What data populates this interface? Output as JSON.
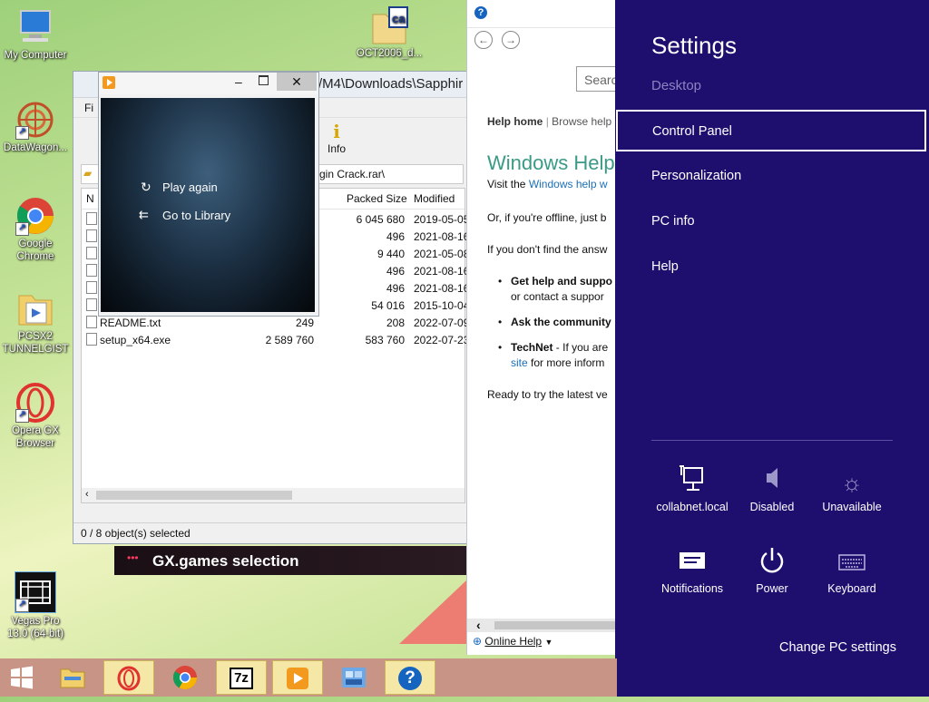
{
  "desktop": {
    "icons": [
      {
        "label": "My Computer",
        "icon": "computer-icon"
      },
      {
        "label": "DataWagon...",
        "icon": "datawagon-icon"
      },
      {
        "label": "Google Chrome",
        "icon": "chrome-icon"
      },
      {
        "label": "PCSX2 TUNNELGIST",
        "icon": "folder-icon"
      },
      {
        "label": "Opera GX Browser",
        "icon": "opera-gx-icon"
      },
      {
        "label": "Vegas Pro 13.0 (64-bit)",
        "icon": "vegas-icon"
      },
      {
        "label": "OCT2006_d...",
        "icon": "file-icon"
      }
    ],
    "gx_banner": "GX.games selection"
  },
  "archive_window": {
    "path": "/M4\\Downloads\\Sapphir",
    "menu_first": "Fi",
    "toolbar_info": "Info",
    "address": "gin Crack.rar\\",
    "columns": {
      "name": "N",
      "size": "",
      "packed": "Packed Size",
      "modified": "Modified"
    },
    "rows": [
      {
        "name": "",
        "size": "",
        "packed": "6 045 680",
        "modified": "2019-05-05"
      },
      {
        "name": "",
        "size": "",
        "packed": "496",
        "modified": "2021-08-16"
      },
      {
        "name": "",
        "size": "",
        "packed": "9 440",
        "modified": "2021-05-08"
      },
      {
        "name": "",
        "size": "",
        "packed": "496",
        "modified": "2021-08-16"
      },
      {
        "name": "",
        "size": "",
        "packed": "496",
        "modified": "2021-08-16"
      },
      {
        "name": "",
        "size": "",
        "packed": "54 016",
        "modified": "2015-10-04"
      },
      {
        "name": "README.txt",
        "size": "249",
        "packed": "208",
        "modified": "2022-07-09"
      },
      {
        "name": "setup_x64.exe",
        "size": "2 589 760",
        "packed": "583 760",
        "modified": "2022-07-23"
      }
    ],
    "status": "0 / 8 object(s) selected"
  },
  "player": {
    "play_again": "Play again",
    "go_to_library": "Go to Library"
  },
  "help": {
    "search_placeholder": "Search",
    "nav_home": "Help home",
    "nav_browse": "Browse help",
    "title": "Windows Help",
    "visit_prefix": "Visit the",
    "visit_link": "Windows help w",
    "offline": "Or, if you're offline, just b",
    "dont_find": "If you don't find the answ",
    "bullet1_bold": "Get help and suppo",
    "bullet1_rest": "or contact a suppor",
    "bullet2_bold": "Ask the community",
    "bullet3_bold": "TechNet",
    "bullet3_rest": "- If you are",
    "bullet3_link": "site",
    "bullet3_tail": "for more inform",
    "ready": "Ready to try the latest ve",
    "online_help": "Online Help"
  },
  "charms": {
    "title": "Settings",
    "subtitle": "Desktop",
    "items": [
      "Control Panel",
      "Personalization",
      "PC info",
      "Help"
    ],
    "tiles": [
      {
        "label": "collabnet.local",
        "icon": "network-icon"
      },
      {
        "label": "Disabled",
        "icon": "volume-icon"
      },
      {
        "label": "Unavailable",
        "icon": "brightness-icon"
      },
      {
        "label": "Notifications",
        "icon": "notifications-icon"
      },
      {
        "label": "Power",
        "icon": "power-icon"
      },
      {
        "label": "Keyboard",
        "icon": "keyboard-icon"
      }
    ],
    "change_pc_settings": "Change PC settings"
  },
  "taskbar": {
    "items": [
      "start-icon",
      "file-explorer-icon",
      "opera-gx-icon",
      "chrome-icon",
      "7zip-icon",
      "media-player-icon",
      "app-icon",
      "help-icon"
    ],
    "sevenzip_label": "7z",
    "help_glyph": "?"
  }
}
